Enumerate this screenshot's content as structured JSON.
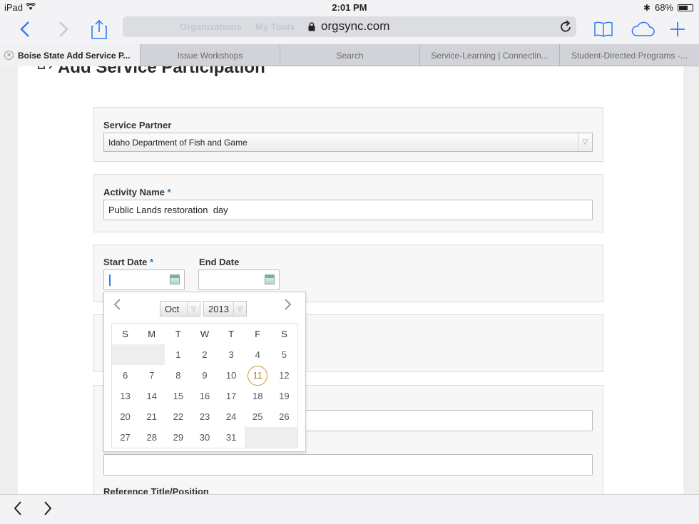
{
  "status": {
    "device": "iPad",
    "time": "2:01 PM",
    "battery": "68%",
    "battery_level": 0.68
  },
  "toolbar": {
    "url": "orgsync.com",
    "ghost_left": "Organizations",
    "ghost_right": "My Tools"
  },
  "tabs": [
    {
      "label": "Boise State Add Service P...",
      "active": true
    },
    {
      "label": "Issue Workshops"
    },
    {
      "label": "Search"
    },
    {
      "label": "Service-Learning | Connectin..."
    },
    {
      "label": "Student-Directed Programs -..."
    }
  ],
  "form": {
    "title": "Add Service Participation",
    "service_partner": {
      "label": "Service Partner",
      "value": "Idaho Department of Fish and Game"
    },
    "activity_name": {
      "label": "Activity Name",
      "required": "*",
      "value": "Public Lands restoration  day"
    },
    "start_date": {
      "label": "Start Date",
      "required": "*",
      "value": ""
    },
    "end_date": {
      "label": "End Date",
      "value": ""
    },
    "reference_title": {
      "label": "Reference Title/Position"
    }
  },
  "datepicker": {
    "month": "Oct",
    "year": "2013",
    "weekdays": [
      "S",
      "M",
      "T",
      "W",
      "T",
      "F",
      "S"
    ],
    "weeks": [
      [
        "",
        "",
        "1",
        "2",
        "3",
        "4",
        "5"
      ],
      [
        "6",
        "7",
        "8",
        "9",
        "10",
        "11",
        "12"
      ],
      [
        "13",
        "14",
        "15",
        "16",
        "17",
        "18",
        "19"
      ],
      [
        "20",
        "21",
        "22",
        "23",
        "24",
        "25",
        "26"
      ],
      [
        "27",
        "28",
        "29",
        "30",
        "31",
        "",
        ""
      ]
    ],
    "today": "11"
  },
  "colors": {
    "accent": "#2d7cf6",
    "today_ring": "#c8992e",
    "required": "#2a6fb8"
  }
}
